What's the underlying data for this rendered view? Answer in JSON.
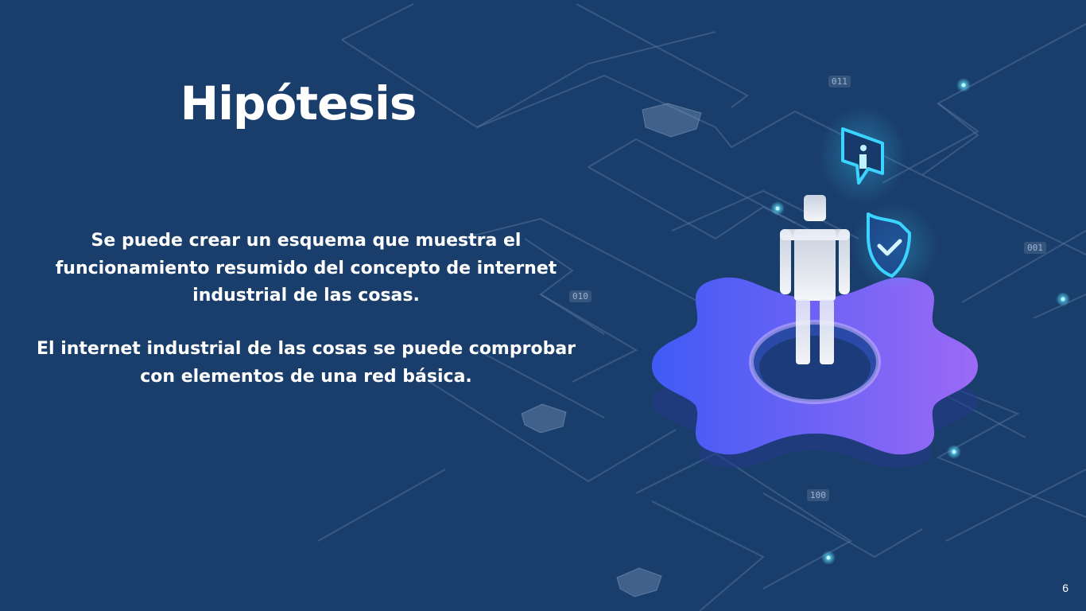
{
  "slide": {
    "title": "Hipótesis",
    "paragraphs": [
      "Se puede crear un esquema que muestra el funcionamiento resumido del concepto de internet industrial de las cosas.",
      "El internet industrial de las cosas se puede comprobar con elementos de una red básica."
    ],
    "page_number": "6"
  },
  "decorations": {
    "binary_tags": [
      "011",
      "001",
      "010",
      "100"
    ],
    "icons": [
      "info-icon",
      "shield-check-icon",
      "gear-icon",
      "person-icon"
    ]
  },
  "colors": {
    "background": "#1a3e6b",
    "gear_start": "#3f5bf5",
    "gear_end": "#9b6af5",
    "accent_cyan": "#3ad4ff"
  }
}
